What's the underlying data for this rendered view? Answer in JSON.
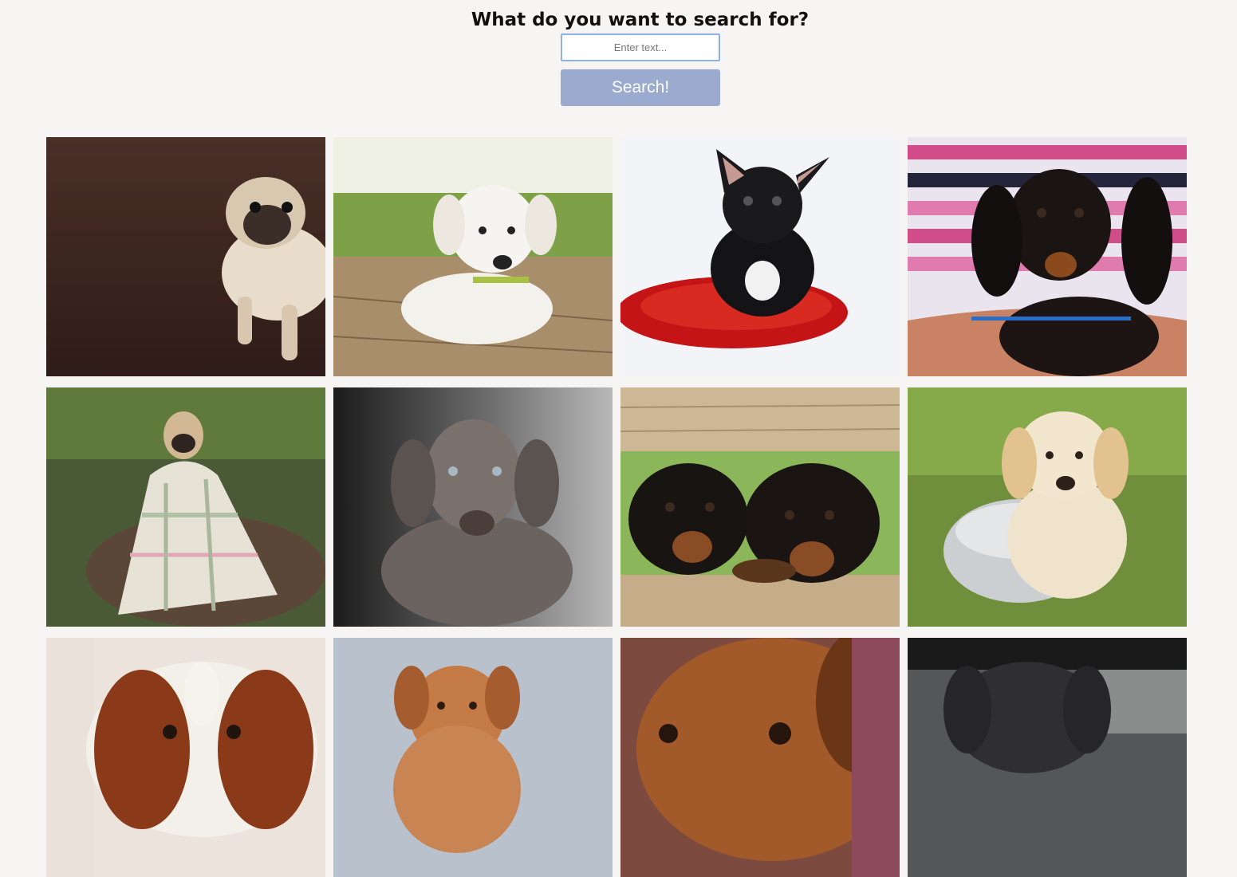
{
  "search": {
    "title": "What do you want to search for?",
    "placeholder": "Enter text...",
    "value": "",
    "button_label": "Search!"
  },
  "results": [
    {
      "subject": "pug puppy on wooden floor",
      "icon": "dog-photo"
    },
    {
      "subject": "white labrador puppy on wooden deck",
      "icon": "dog-photo"
    },
    {
      "subject": "black french bulldog on red cushion",
      "icon": "dog-photo"
    },
    {
      "subject": "dachshund puppy held in arms",
      "icon": "dog-photo"
    },
    {
      "subject": "pug wrapped in plaid blanket",
      "icon": "dog-photo"
    },
    {
      "subject": "grey weimaraner puppy",
      "icon": "dog-photo"
    },
    {
      "subject": "two rottweiler puppies behind fence",
      "icon": "dog-photo"
    },
    {
      "subject": "golden retriever puppy in bowl",
      "icon": "dog-photo"
    },
    {
      "subject": "cavalier spaniel puppy",
      "icon": "dog-photo"
    },
    {
      "subject": "brown puppy on grey background",
      "icon": "dog-photo"
    },
    {
      "subject": "brown puppy close-up",
      "icon": "dog-photo"
    },
    {
      "subject": "grey puppy in truck",
      "icon": "dog-photo"
    }
  ]
}
